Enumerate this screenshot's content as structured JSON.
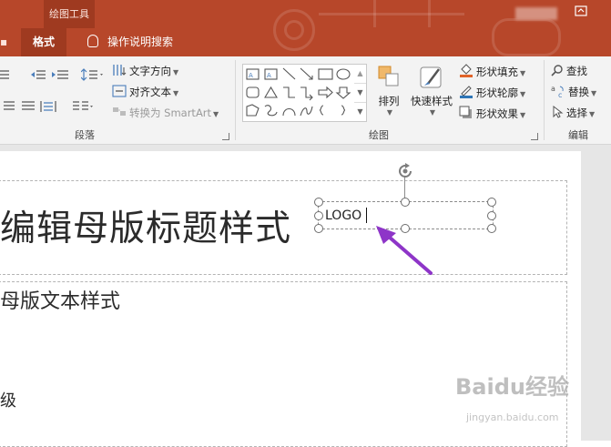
{
  "window": {
    "contextual_tab": "绘图工具",
    "active_tab": "格式",
    "tell_me": "操作说明搜索"
  },
  "ribbon": {
    "paragraph_group": {
      "label": "段落",
      "text_direction": "文字方向",
      "align_text": "对齐文本",
      "convert_smartart": "转换为 SmartArt"
    },
    "drawing_group": {
      "label": "绘图",
      "arrange": "排列",
      "quick_styles": "快速样式",
      "shape_fill": "形状填充",
      "shape_outline": "形状轮廓",
      "shape_effects": "形状效果"
    },
    "editing_group": {
      "label": "编辑",
      "find": "查找",
      "replace": "替换",
      "select": "选择"
    }
  },
  "slide": {
    "title_placeholder": "编辑母版标题样式",
    "body_placeholder": "母版文本样式",
    "level_text": "级",
    "logo_textbox": "LOGO"
  },
  "watermark": {
    "brand": "Baidu经验",
    "url": "jingyan.baidu.com"
  },
  "colors": {
    "titlebar": "#b7472a",
    "annotation_arrow": "#8e35c8"
  }
}
